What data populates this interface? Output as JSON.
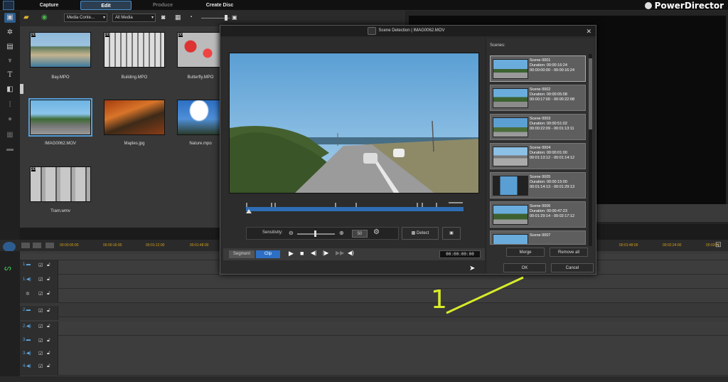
{
  "topbar": {
    "tabs": [
      "Capture",
      "Edit",
      "Produce",
      "Create Disc"
    ],
    "brand": "PowerDirector"
  },
  "library": {
    "filter1": "Media Conte...",
    "filter2": "All Media",
    "items": [
      {
        "label": "Bay.MPO",
        "badge": "3D"
      },
      {
        "label": "Building.MPO",
        "badge": "3D"
      },
      {
        "label": "Butterfly.MPO",
        "badge": "3D"
      },
      {
        "label": "IMAG0062.MOV",
        "badge": ""
      },
      {
        "label": "Maples.jpg",
        "badge": ""
      },
      {
        "label": "Nature.mpo",
        "badge": ""
      },
      {
        "label": "Tram.wmv",
        "badge": "3D"
      }
    ]
  },
  "timeline": {
    "ticks": [
      "00:00:00:00",
      "00:00:16:00",
      "00:01:12:00",
      "00:01:48:00",
      "00:01:48:00",
      "00:02:24:00",
      "00:03:00"
    ]
  },
  "dialog": {
    "title": "Scene Detection | IMAG0062.MOV",
    "scenes_label": "Scenes:",
    "sensitivity_label": "Sensitivity:",
    "sensitivity_value": "50",
    "detect_label": "Detect",
    "segment_label": "Segment",
    "clip_label": "Clip",
    "timecode": "00:00:00:00",
    "merge_label": "Merge",
    "remove_all_label": "Remove all",
    "ok_label": "OK",
    "cancel_label": "Cancel",
    "scenes": [
      {
        "name": "Scene 0001",
        "duration": "Duration: 00:00:16:24",
        "range": "00:00:00:00 - 00:00:16:24"
      },
      {
        "name": "Scene 0002",
        "duration": "Duration: 00:00:05:08",
        "range": "00:00:17:00 - 00:00:22:08"
      },
      {
        "name": "Scene 0003",
        "duration": "Duration: 00:00:51:02",
        "range": "00:00:22:09 - 00:01:13:11"
      },
      {
        "name": "Scene 0004",
        "duration": "Duration: 00:00:01:00",
        "range": "00:01:13:12 - 00:01:14:12"
      },
      {
        "name": "Scene 0005",
        "duration": "Duration: 00:00:15:00",
        "range": "00:01:14:13 - 00:01:29:13"
      },
      {
        "name": "Scene 0006",
        "duration": "Duration: 00:00:47:23",
        "range": "00:01:29:14 - 00:02:17:12"
      },
      {
        "name": "Scene 0007",
        "duration": "",
        "range": ""
      }
    ]
  },
  "annotation": {
    "number": "1",
    "color": "#d8ec2a"
  }
}
